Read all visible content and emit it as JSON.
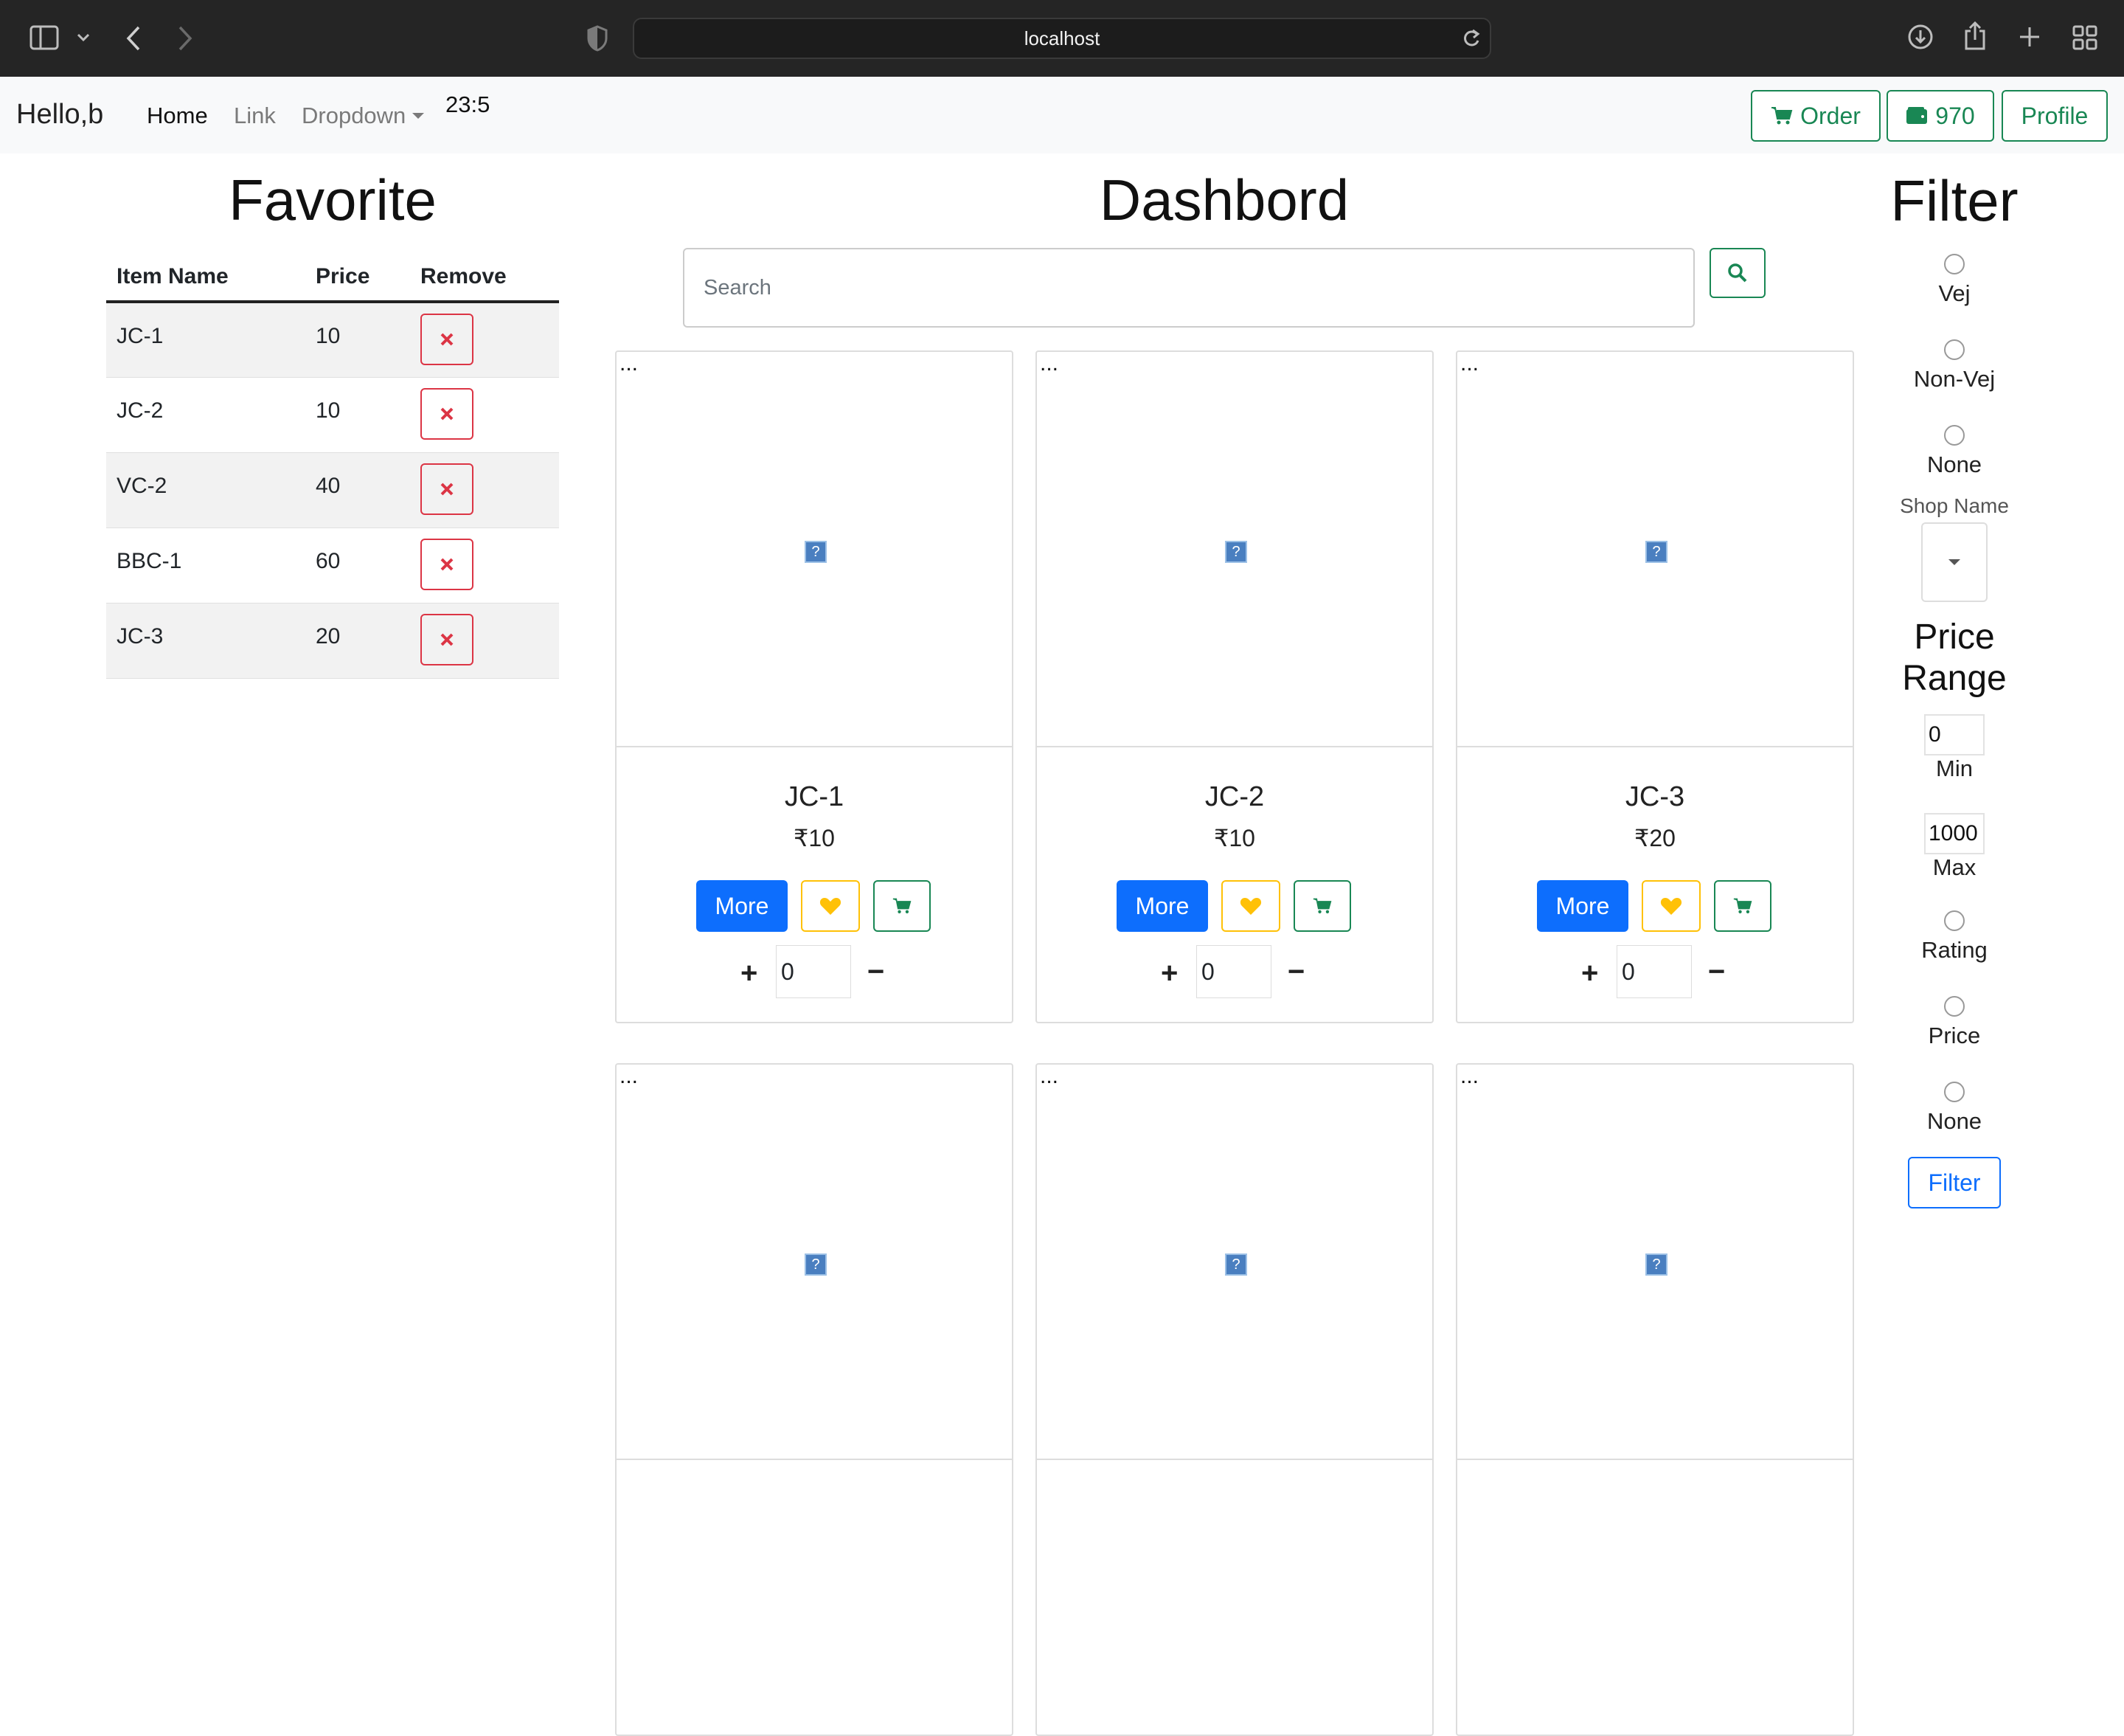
{
  "browser": {
    "url": "localhost"
  },
  "navbar": {
    "brand": "Hello,b",
    "links": [
      "Home",
      "Link",
      "Dropdown"
    ],
    "clock": "23:5",
    "order_label": "Order",
    "wallet_value": "970",
    "profile_label": "Profile"
  },
  "favorite": {
    "title": "Favorite",
    "headers": [
      "Item Name",
      "Price",
      "Remove"
    ],
    "rows": [
      {
        "name": "JC-1",
        "price": "10"
      },
      {
        "name": "JC-2",
        "price": "10"
      },
      {
        "name": "VC-2",
        "price": "40"
      },
      {
        "name": "BBC-1",
        "price": "60"
      },
      {
        "name": "JC-3",
        "price": "20"
      }
    ]
  },
  "dashboard": {
    "title": "Dashbord",
    "search_placeholder": "Search",
    "more_label": "More",
    "cards": [
      {
        "name": "JC-1",
        "price": "₹10",
        "qty": "0"
      },
      {
        "name": "JC-2",
        "price": "₹10",
        "qty": "0"
      },
      {
        "name": "JC-3",
        "price": "₹20",
        "qty": "0"
      }
    ]
  },
  "filter": {
    "title": "Filter",
    "type_options": [
      "Vej",
      "Non-Vej",
      "None"
    ],
    "shop_label": "Shop Name",
    "price_range_title": "Price Range",
    "min_value": "0",
    "min_label": "Min",
    "max_value": "1000",
    "max_label": "Max",
    "sort_options": [
      "Rating",
      "Price",
      "None"
    ],
    "filter_button": "Filter"
  },
  "colors": {
    "primary": "#0d6efd",
    "success": "#198754",
    "danger": "#dc3545",
    "warning": "#ffc107"
  }
}
